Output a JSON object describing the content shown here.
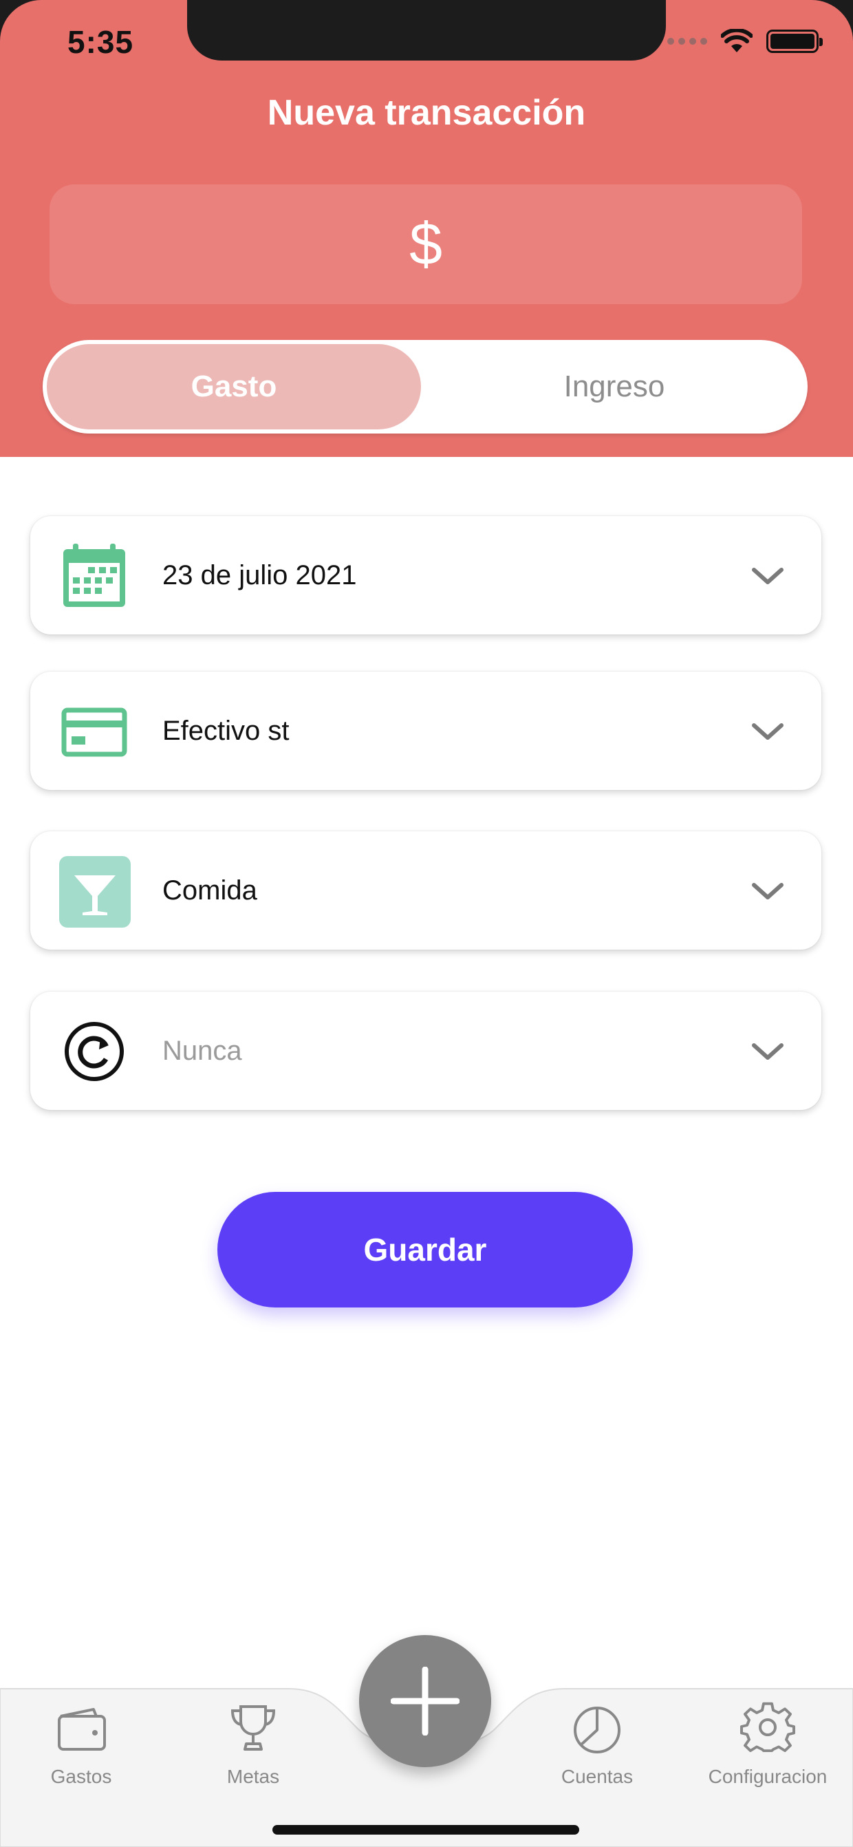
{
  "status_bar": {
    "time": "5:35"
  },
  "header": {
    "title": "Nueva transacción",
    "amount_symbol": "$",
    "segment": {
      "left_label": "Gasto",
      "right_label": "Ingreso",
      "selected": "Gasto"
    }
  },
  "form": {
    "date": {
      "value": "23 de julio 2021",
      "icon": "calendar-icon"
    },
    "account": {
      "value": "Efectivo st",
      "icon": "credit-card-icon"
    },
    "category": {
      "value": "Comida",
      "icon": "cocktail-icon"
    },
    "repeat": {
      "value": "Nunca",
      "icon": "repeat-icon"
    }
  },
  "save_button": {
    "label": "Guardar"
  },
  "tab_bar": {
    "items": [
      {
        "label": "Gastos",
        "icon": "wallet-icon"
      },
      {
        "label": "Metas",
        "icon": "trophy-icon"
      },
      {
        "label": "Cuentas",
        "icon": "pie-chart-icon"
      },
      {
        "label": "Configuracion",
        "icon": "gear-icon"
      }
    ],
    "fab_icon": "plus-icon"
  },
  "colors": {
    "header": "#e8706b",
    "segment_selected": "#edb9b6",
    "accent_green": "#5fc38f",
    "category_bg": "#a3dccb",
    "save_button": "#5b3ef5",
    "fab": "#848484"
  }
}
